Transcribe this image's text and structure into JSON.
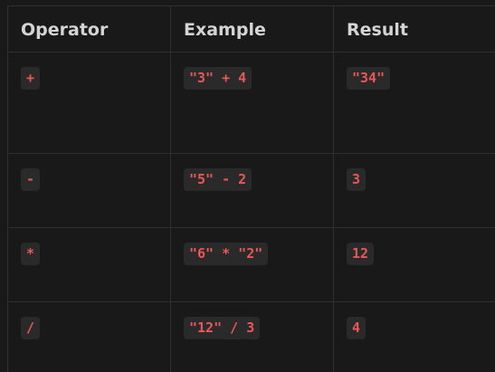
{
  "table": {
    "headers": [
      "Operator",
      "Example",
      "Result"
    ],
    "rows": [
      {
        "operator": "+",
        "example": "\"3\" + 4",
        "result": "\"34\""
      },
      {
        "operator": "-",
        "example": "\"5\" - 2",
        "result": "3"
      },
      {
        "operator": "*",
        "example": "\"6\" * \"2\"",
        "result": "12"
      },
      {
        "operator": "/",
        "example": "\"12\" / 3",
        "result": "4"
      }
    ]
  },
  "colors": {
    "background": "#191919",
    "header_text": "#d4d4d4",
    "code_text": "#eb5757",
    "code_background": "#2a2a2a",
    "border": "#2f2f2f"
  }
}
